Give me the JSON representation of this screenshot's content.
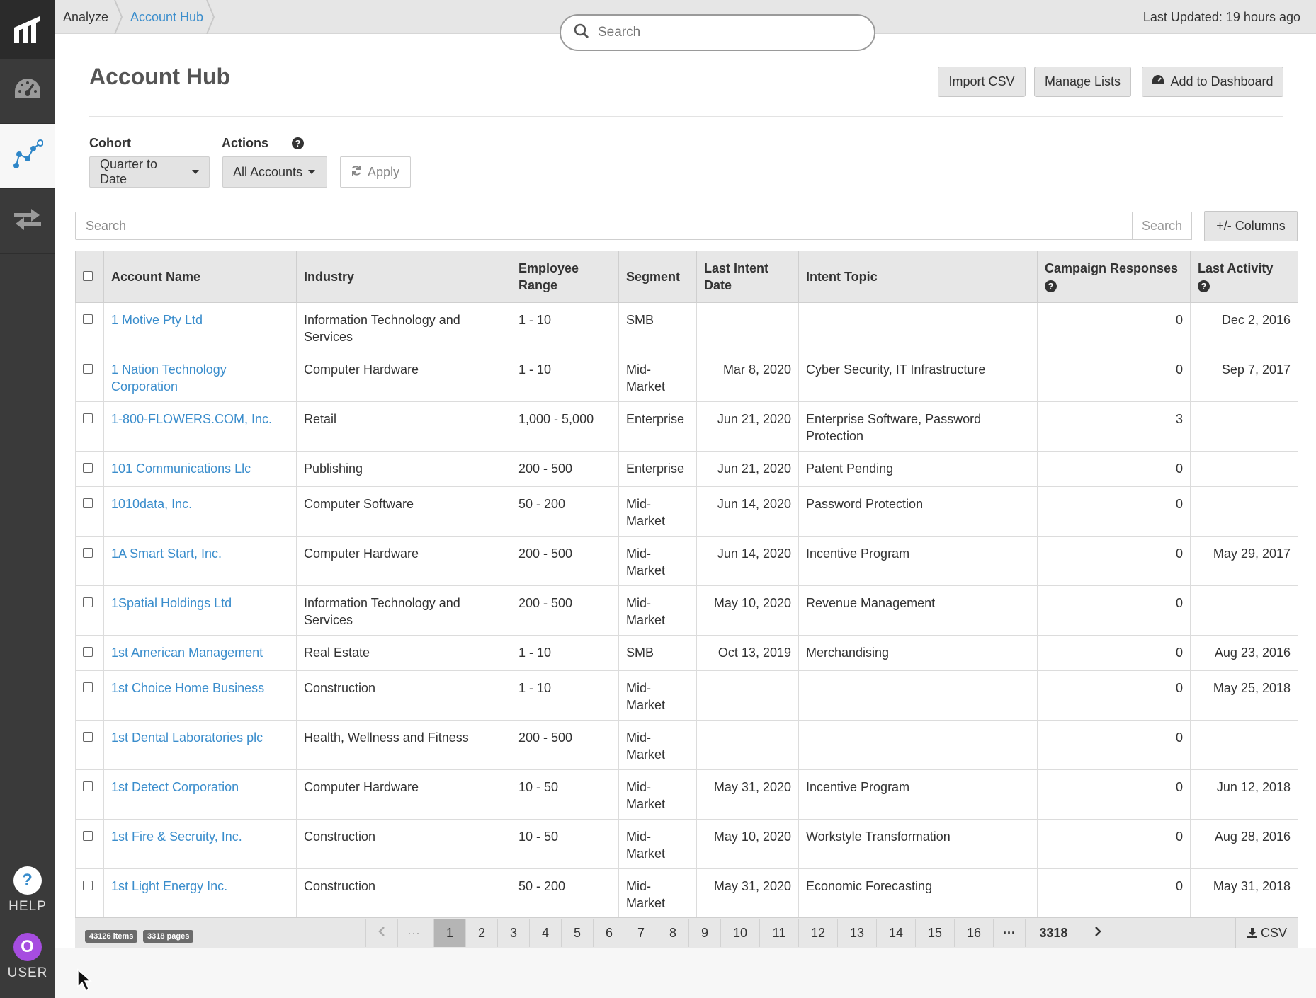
{
  "breadcrumb": {
    "items": [
      "Analyze",
      "Account Hub"
    ]
  },
  "header": {
    "last_updated": "Last Updated: 19 hours ago",
    "search_placeholder": "Search"
  },
  "page": {
    "title": "Account Hub",
    "buttons": {
      "import_csv": "Import CSV",
      "manage_lists": "Manage Lists",
      "add_to_dashboard": "Add to Dashboard"
    }
  },
  "filters": {
    "cohort_label": "Cohort",
    "cohort_value": "Quarter to Date",
    "actions_label": "Actions",
    "actions_value": "All Accounts",
    "apply": "Apply"
  },
  "table_search": {
    "placeholder": "Search",
    "button": "Search",
    "columns_button": "+/- Columns"
  },
  "table": {
    "columns": [
      "Account Name",
      "Industry",
      "Employee Range",
      "Segment",
      "Last Intent Date",
      "Intent Topic",
      "Campaign Responses",
      "Last Activity"
    ],
    "rows": [
      {
        "name": "1 Motive Pty Ltd",
        "industry": "Information Technology and Services",
        "range": "1 - 10",
        "segment": "SMB",
        "intent_date": "",
        "topic": "",
        "responses": "0",
        "activity": "Dec 2, 2016"
      },
      {
        "name": "1 Nation Technology Corporation",
        "industry": "Computer Hardware",
        "range": "1 - 10",
        "segment": "Mid-Market",
        "intent_date": "Mar 8, 2020",
        "topic": "Cyber Security, IT Infrastructure",
        "responses": "0",
        "activity": "Sep 7, 2017"
      },
      {
        "name": "1-800-FLOWERS.COM, Inc.",
        "industry": "Retail",
        "range": "1,000 - 5,000",
        "segment": "Enterprise",
        "intent_date": "Jun 21, 2020",
        "topic": "Enterprise Software, Password Protection",
        "responses": "3",
        "activity": ""
      },
      {
        "name": "101 Communications Llc",
        "industry": "Publishing",
        "range": "200 - 500",
        "segment": "Enterprise",
        "intent_date": "Jun 21, 2020",
        "topic": "Patent Pending",
        "responses": "0",
        "activity": ""
      },
      {
        "name": "1010data, Inc.",
        "industry": "Computer Software",
        "range": "50 - 200",
        "segment": "Mid-Market",
        "intent_date": "Jun 14, 2020",
        "topic": "Password Protection",
        "responses": "0",
        "activity": ""
      },
      {
        "name": "1A Smart Start, Inc.",
        "industry": "Computer Hardware",
        "range": "200 - 500",
        "segment": "Mid-Market",
        "intent_date": "Jun 14, 2020",
        "topic": "Incentive Program",
        "responses": "0",
        "activity": "May 29, 2017"
      },
      {
        "name": "1Spatial Holdings Ltd",
        "industry": "Information Technology and Services",
        "range": "200 - 500",
        "segment": "Mid-Market",
        "intent_date": "May 10, 2020",
        "topic": "Revenue Management",
        "responses": "0",
        "activity": ""
      },
      {
        "name": "1st American Management",
        "industry": "Real Estate",
        "range": "1 - 10",
        "segment": "SMB",
        "intent_date": "Oct 13, 2019",
        "topic": "Merchandising",
        "responses": "0",
        "activity": "Aug 23, 2016"
      },
      {
        "name": "1st Choice Home Business",
        "industry": "Construction",
        "range": "1 - 10",
        "segment": "Mid-Market",
        "intent_date": "",
        "topic": "",
        "responses": "0",
        "activity": "May 25, 2018"
      },
      {
        "name": "1st Dental Laboratories plc",
        "industry": "Health, Wellness and Fitness",
        "range": "200 - 500",
        "segment": "Mid-Market",
        "intent_date": "",
        "topic": "",
        "responses": "0",
        "activity": ""
      },
      {
        "name": "1st Detect Corporation",
        "industry": "Computer Hardware",
        "range": "10 - 50",
        "segment": "Mid-Market",
        "intent_date": "May 31, 2020",
        "topic": "Incentive Program",
        "responses": "0",
        "activity": "Jun 12, 2018"
      },
      {
        "name": "1st Fire & Secruity, Inc.",
        "industry": "Construction",
        "range": "10 - 50",
        "segment": "Mid-Market",
        "intent_date": "May 10, 2020",
        "topic": "Workstyle Transformation",
        "responses": "0",
        "activity": "Aug 28, 2016"
      },
      {
        "name": "1st Light Energy Inc.",
        "industry": "Construction",
        "range": "50 - 200",
        "segment": "Mid-Market",
        "intent_date": "May 31, 2020",
        "topic": "Economic Forecasting",
        "responses": "0",
        "activity": "May 31, 2018"
      }
    ]
  },
  "pager": {
    "items_badge": "43126 items",
    "pages_badge": "3318 pages",
    "pages": [
      "1",
      "2",
      "3",
      "4",
      "5",
      "6",
      "7",
      "8",
      "9",
      "10",
      "11",
      "12",
      "13",
      "14",
      "15",
      "16"
    ],
    "ellipsis": "···",
    "last_page": "3318",
    "current_page": "1",
    "csv": "CSV"
  },
  "sidebar": {
    "help_label": "HELP",
    "user_label": "USER",
    "user_initial": "O"
  },
  "colors": {
    "link": "#3a8dcc",
    "sidebar": "#3a3a3a",
    "user_avatar": "#a64de0"
  },
  "icons": {
    "logo": "brand-logo-icon",
    "dashboard": "speedometer-icon",
    "analyze": "scatter-nodes-icon",
    "transfer": "arrows-transfer-icon"
  }
}
